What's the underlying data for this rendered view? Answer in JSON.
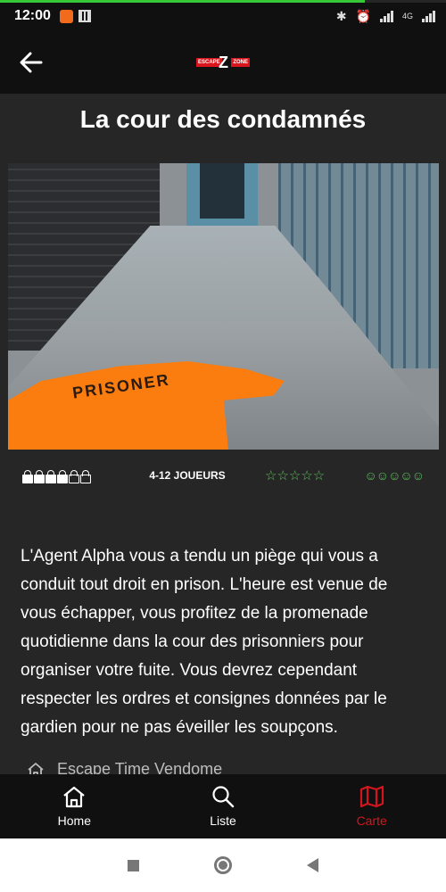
{
  "status_bar": {
    "time": "12:00",
    "network": "4G"
  },
  "header": {
    "logo": {
      "left_text": "ESCAPE",
      "right_text": "ZONE",
      "center_glyph": "Z"
    }
  },
  "room": {
    "title": "La cour des condamnés",
    "image_caption": "PRISONER",
    "difficulty": {
      "value": 4,
      "max": 6,
      "icon": "lock-icon"
    },
    "players": "4-12 JOUEURS",
    "rating": {
      "value": 0,
      "max": 5,
      "glyph": "☆☆☆☆☆"
    },
    "fun": {
      "value": 0,
      "max": 5,
      "glyph": "☺☺☺☺☺"
    },
    "description": "L'Agent Alpha vous a tendu un piège qui vous a conduit tout droit en prison. L'heure est venue de vous échapper, vous profitez de la promenade quotidienne dans la cour des prisonniers pour organiser votre fuite. Vous devrez cependant respecter les ordres et consignes données par le gardien pour ne pas éveiller les soupçons.",
    "location": "Escape Time Vendome"
  },
  "bottom_nav": {
    "items": [
      {
        "label": "Home",
        "icon": "home-icon"
      },
      {
        "label": "Liste",
        "icon": "search-icon"
      },
      {
        "label": "Carte",
        "icon": "map-icon",
        "active": true
      }
    ]
  },
  "colors": {
    "accent": "#d3161d",
    "rating_green": "#5fbe5f",
    "background": "#262626",
    "bar": "#101010"
  }
}
